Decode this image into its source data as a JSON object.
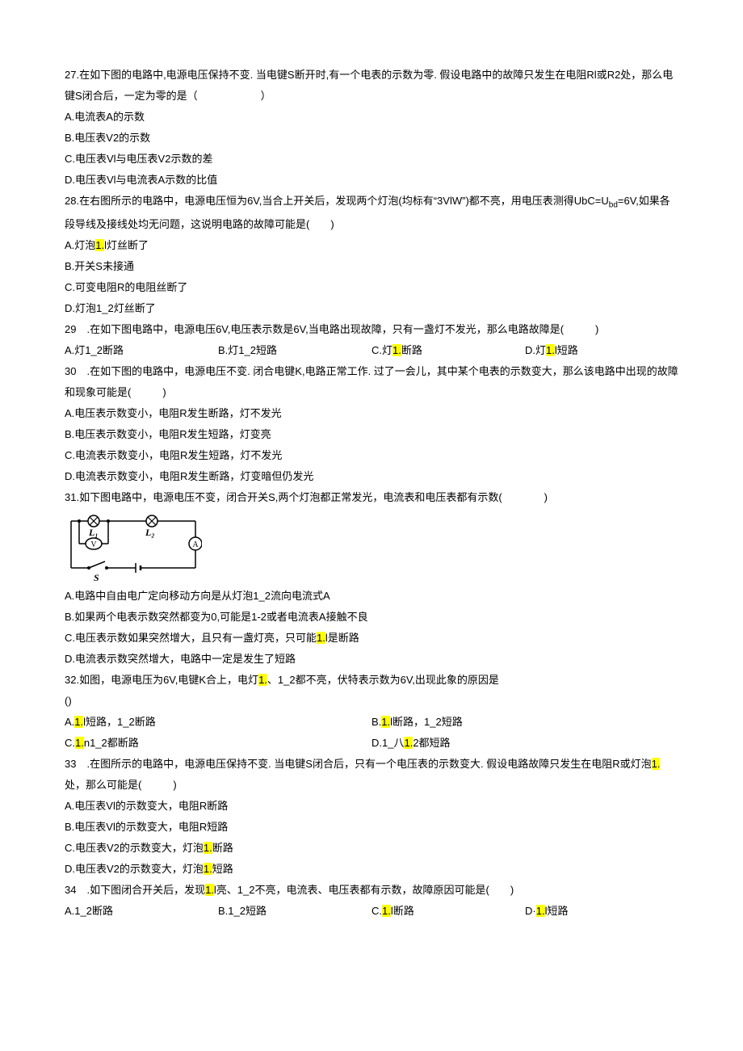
{
  "q27": {
    "stem": "27.在如下图的电路中,电源电压保持不变. 当电键S断开时,有一个电表的示数为零. 假设电路中的故障只发生在电阻Rl或R2处，那么电键S闭合后，一定为零的是（　　　　　　）",
    "A": "A.电流表A的示数",
    "B": "B.电压表V2的示数",
    "C": "C.电压表Vl与电压表V2示数的差",
    "D": "D.电压表Vl与电流表A示数的比值"
  },
  "q28": {
    "stem1": "28.在右图所示的电路中，电源电压恒为6V,当合上开关后，发现两个灯泡(均标有“3VlW”)都不亮，用电压表测得UbC=U",
    "stem_sub": "bd",
    "stem2": "=6V,如果各段导线及接线处均无问题，这说明电路的故障可能是(　　)",
    "A_pre": "A.灯泡",
    "A_hl": "1.",
    "A_post": "l灯丝断了",
    "B": "B.开关S未接通",
    "C": "C.可变电阻R的电阻丝断了",
    "D": "D.灯泡1_2灯丝断了"
  },
  "q29": {
    "stem": "29　.在如下图电路中，电源电压6V,电压表示数是6V,当电路出现故障，只有一盏灯不发光，那么电路故障是(　　　)",
    "A": "A.灯1_2断路",
    "B": "B.灯1_2短路",
    "C_pre": "C.灯",
    "C_hl": "1.",
    "C_post": "断路",
    "D_pre": "D.灯",
    "D_hl": "1.",
    "D_post": "l短路"
  },
  "q30": {
    "stem": "30　.在如下图的电路中，电源电压不变. 闭合电键K,电路正常工作. 过了一会儿，其中某个电表的示数变大，那么该电路中出现的故障和现象可能是(　　　)",
    "A": "A.电压表示数变小，电阻R发生断路，灯不发光",
    "B": "B.电压表示数变小，电阻R发生短路，灯变亮",
    "C": "C.电流表示数变小，电阻R发生短路，灯不发光",
    "D": "D.电流表示数变小，电阻R发生断路，灯变暗但仍发光"
  },
  "q31": {
    "stem": "31.如下图电路中，电源电压不变，闭合开关S,两个灯泡都正常发光，电流表和电压表都有示数(　　　　)",
    "labels": {
      "L1": "L₁",
      "L2": "L₂",
      "V": "V",
      "A": "A",
      "S": "S"
    },
    "A": "A.电路中自由电广定向移动方向是从灯泡1_2流向电流式A",
    "B": "B.如果两个电表示数突然都变为0,可能是1-2或者电流表A接触不良",
    "C_pre": "C.电压表示数如果突然增大，且只有一盏灯亮，只可能",
    "C_hl": "1.",
    "C_post": "l是断路",
    "D": "D.电流表示数突然增大，电路中一定是发生了短路"
  },
  "q32": {
    "stem_pre": "32.如图，电源电压为6V,电键K合上，电灯",
    "stem_hl": "1.",
    "stem_post": "、1_2都不亮，伏特表示数为6V,出现此象的原因是",
    "paren": "()",
    "A_pre": "A.",
    "A_hl": "1.",
    "A_post": "l短路，1_2断路",
    "B_pre": "B.",
    "B_hl": "1.",
    "B_post": "l断路，1_2短路",
    "C_pre": "C.",
    "C_hl": "1.",
    "C_post": "n1_2都断路",
    "D_pre": "D.1_八",
    "D_hl": "1.",
    "D_post": "2都短路"
  },
  "q33": {
    "stem_pre": "33　.在图所示的电路中，电源电压保持不变. 当电键S闭合后，只有一个电压表的示数变大. 假设电路故障只发生在电阻R或灯泡",
    "stem_hl": "1.",
    "stem_post": "处，那么可能是(　　　)",
    "A": "A.电压表Vl的示数变大，电阻R断路",
    "B": "B.电压表Vl的示数变大，电阻R短路",
    "C_pre": "C.电压表V2的示数变大，灯泡",
    "C_hl": "1.",
    "C_post": "断路",
    "D_pre": "D.电压表V2的示数变大，灯泡",
    "D_hl": "1.",
    "D_post": "短路"
  },
  "q34": {
    "stem_pre": "34　.如下图闭合开关后，发现",
    "stem_hl": "1.",
    "stem_post": "l亮、1_2不亮，电流表、电压表都有示数，故障原因可能是(　　)",
    "A": "A.1_2断路",
    "B": "B.1_2短路",
    "C_pre": "C.",
    "C_hl": "1.",
    "C_post": "l断路",
    "D_pre": "D·",
    "D_hl": "1.",
    "D_post": "l短路"
  }
}
